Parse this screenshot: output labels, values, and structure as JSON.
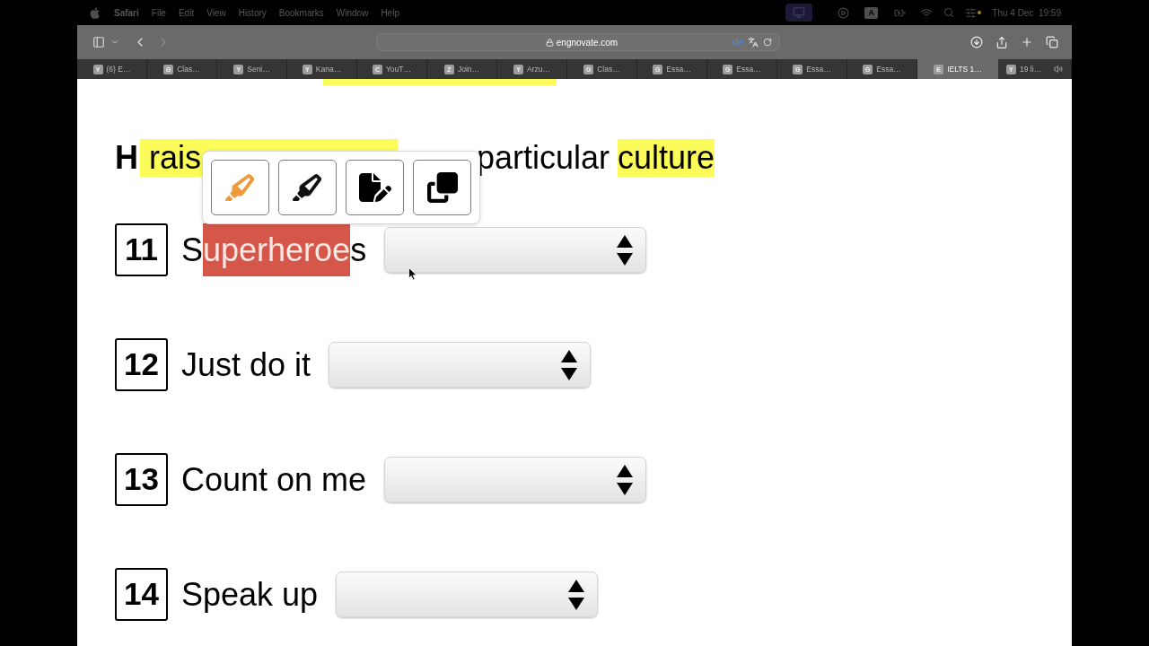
{
  "menu_bar": {
    "app": "Safari",
    "menus": [
      "File",
      "Edit",
      "View",
      "History",
      "Bookmarks",
      "Window",
      "Help"
    ],
    "input_source": "A",
    "clock": "Thu 4 Dec  19:59"
  },
  "toolbar": {
    "address": "engnovate.com",
    "audio_playing": true
  },
  "tabs": [
    {
      "icon_letter": "Y",
      "title": "(6) E…",
      "selected": false,
      "playing_audio": false
    },
    {
      "icon_letter": "G",
      "title": "Clas…",
      "selected": false,
      "playing_audio": false
    },
    {
      "icon_letter": "Y",
      "title": "Seni…",
      "selected": false,
      "playing_audio": false
    },
    {
      "icon_letter": "Y",
      "title": "Kana…",
      "selected": false,
      "playing_audio": false
    },
    {
      "icon_letter": "C",
      "title": "YouT…",
      "selected": false,
      "playing_audio": false
    },
    {
      "icon_letter": "Z",
      "title": "Join…",
      "selected": false,
      "playing_audio": false
    },
    {
      "icon_letter": "Y",
      "title": "Arzu…",
      "selected": false,
      "playing_audio": false
    },
    {
      "icon_letter": "G",
      "title": "Clas…",
      "selected": false,
      "playing_audio": false
    },
    {
      "icon_letter": "G",
      "title": "Essa…",
      "selected": false,
      "playing_audio": false
    },
    {
      "icon_letter": "G",
      "title": "Essa…",
      "selected": false,
      "playing_audio": false
    },
    {
      "icon_letter": "G",
      "title": "Essa…",
      "selected": false,
      "playing_audio": false
    },
    {
      "icon_letter": "G",
      "title": "Essa…",
      "selected": false,
      "playing_audio": false
    },
    {
      "icon_letter": "E",
      "title": "IELTS 1…",
      "selected": true,
      "playing_audio": false
    },
    {
      "icon_letter": "Y",
      "title": "19 li…",
      "selected": false,
      "playing_audio": true
    }
  ],
  "heading": {
    "fragments": [
      {
        "parts": [
          {
            "text": "**H**",
            "highlighted": false
          },
          {
            "text": "rais",
            "highlighted": true
          }
        ]
      },
      {
        "parts": [
          {
            "text": "particular",
            "highlighted": false
          },
          {
            "text": "culture",
            "highlighted": true
          }
        ]
      }
    ]
  },
  "highlight_toolbar": {
    "buttons": [
      {
        "kind": "highlighter",
        "color": "#ee9a3a"
      },
      {
        "kind": "highlighter",
        "color": "#111111"
      },
      {
        "kind": "note"
      },
      {
        "kind": "copy"
      }
    ]
  },
  "questions": [
    {
      "number": "11",
      "label": [
        {
          "text": "S",
          "selected": false
        },
        {
          "text": "uperheroe",
          "selected": true
        },
        {
          "text": "s",
          "selected": false
        }
      ]
    },
    {
      "number": "12",
      "label": [
        {
          "text": "Just do it",
          "selected": false
        }
      ]
    },
    {
      "number": "13",
      "label": [
        {
          "text": "Count on me",
          "selected": false
        }
      ]
    },
    {
      "number": "14",
      "label": [
        {
          "text": "Speak up",
          "selected": false
        }
      ]
    }
  ]
}
